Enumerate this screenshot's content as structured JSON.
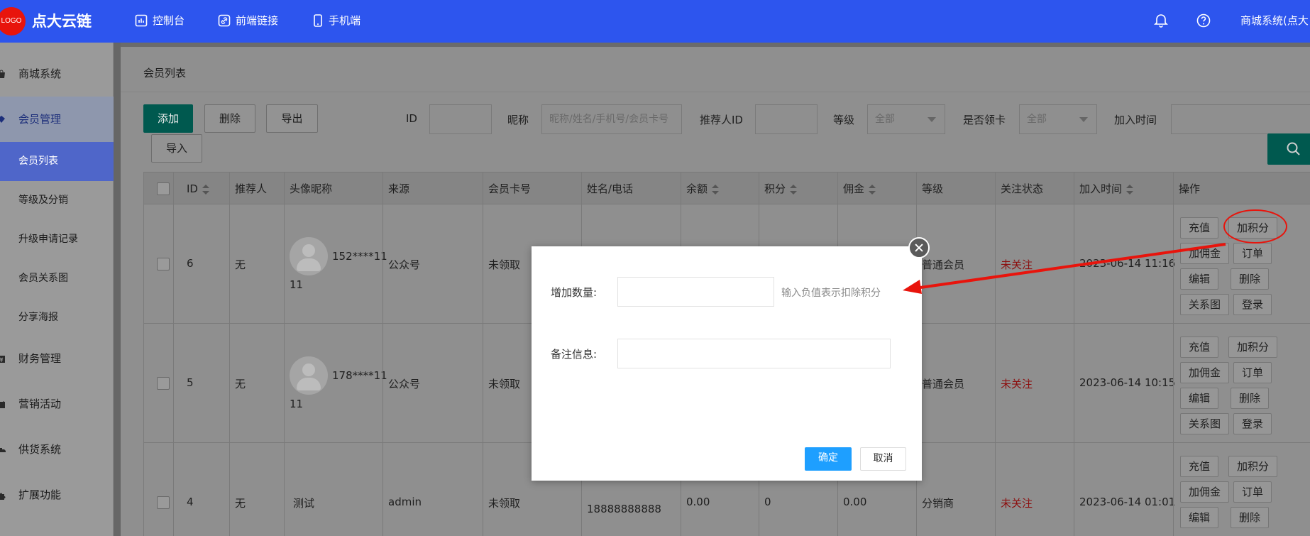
{
  "header": {
    "logo_text": "LOGO",
    "brand": "点大云链",
    "nav": [
      {
        "label": "控制台",
        "icon": "dashboard-icon"
      },
      {
        "label": "前端链接",
        "icon": "link-icon"
      },
      {
        "label": "手机端",
        "icon": "mobile-icon"
      }
    ],
    "user": "商城系统(点大"
  },
  "sidebar": {
    "items": [
      {
        "label": "商城系统",
        "icon": "shop-bag-icon"
      },
      {
        "label": "会员管理",
        "icon": "member-diamond-icon"
      },
      {
        "label": "会员列表"
      },
      {
        "label": "等级及分销"
      },
      {
        "label": "升级申请记录"
      },
      {
        "label": "会员关系图"
      },
      {
        "label": "分享海报"
      },
      {
        "label": "财务管理",
        "icon": "finance-icon"
      },
      {
        "label": "营销活动",
        "icon": "marketing-icon"
      },
      {
        "label": "供货系统",
        "icon": "supply-truck-icon"
      },
      {
        "label": "扩展功能",
        "icon": "extension-puzzle-icon"
      }
    ]
  },
  "page": {
    "title": "会员列表"
  },
  "toolbar": {
    "add": "添加",
    "delete": "删除",
    "export": "导出",
    "import": "导入"
  },
  "filters": {
    "id_label": "ID",
    "nickname_label": "昵称",
    "nickname_placeholder": "昵称/姓名/手机号/会员卡号",
    "referrer_label": "推荐人ID",
    "level_label": "等级",
    "level_value": "全部",
    "card_label": "是否领卡",
    "card_value": "全部",
    "join_label": "加入时间"
  },
  "table": {
    "headers": [
      "ID",
      "推荐人",
      "头像昵称",
      "来源",
      "会员卡号",
      "姓名/电话",
      "余额",
      "积分",
      "佣金",
      "等级",
      "关注状态",
      "加入时间",
      "操作"
    ],
    "rows": [
      {
        "id": "6",
        "referrer": "无",
        "nick_line1": "152****11",
        "nick_line2": "11",
        "source": "公众号",
        "card": "未领取",
        "name_phone": "",
        "balance": "",
        "points": "",
        "commission": "",
        "level": "普通会员",
        "follow": "未关注",
        "join": "2023-06-14 11:16"
      },
      {
        "id": "5",
        "referrer": "无",
        "nick_line1": "178****11",
        "nick_line2": "11",
        "source": "公众号",
        "card": "未领取",
        "name_phone": "",
        "balance": "",
        "points": "",
        "commission": "",
        "level": "普通会员",
        "follow": "未关注",
        "join": "2023-06-14 10:15"
      },
      {
        "id": "4",
        "referrer": "无",
        "nick_line1": "测试",
        "nick_line2": "",
        "source": "admin",
        "card": "未领取",
        "name_phone": "18888888888",
        "balance": "0.00",
        "points": "0",
        "commission": "0.00",
        "level": "分销商",
        "follow": "未关注",
        "join": "2023-06-14 01:01"
      }
    ],
    "ops": {
      "recharge": "充值",
      "add_points": "加积分",
      "add_commission": "加佣金",
      "orders": "订单",
      "edit": "编辑",
      "remove": "删除",
      "relation": "关系图",
      "login": "登录"
    }
  },
  "modal": {
    "amount_label": "增加数量:",
    "amount_value": "",
    "hint": "输入负值表示扣除积分",
    "remark_label": "备注信息:",
    "remark_value": "",
    "confirm": "确定",
    "cancel": "取消"
  },
  "colors": {
    "header_blue": "#2d55ee",
    "logo_red": "#e8140c",
    "primary_green": "#009688",
    "confirm_blue": "#1e9fff",
    "annotation_red": "#e8140c"
  }
}
